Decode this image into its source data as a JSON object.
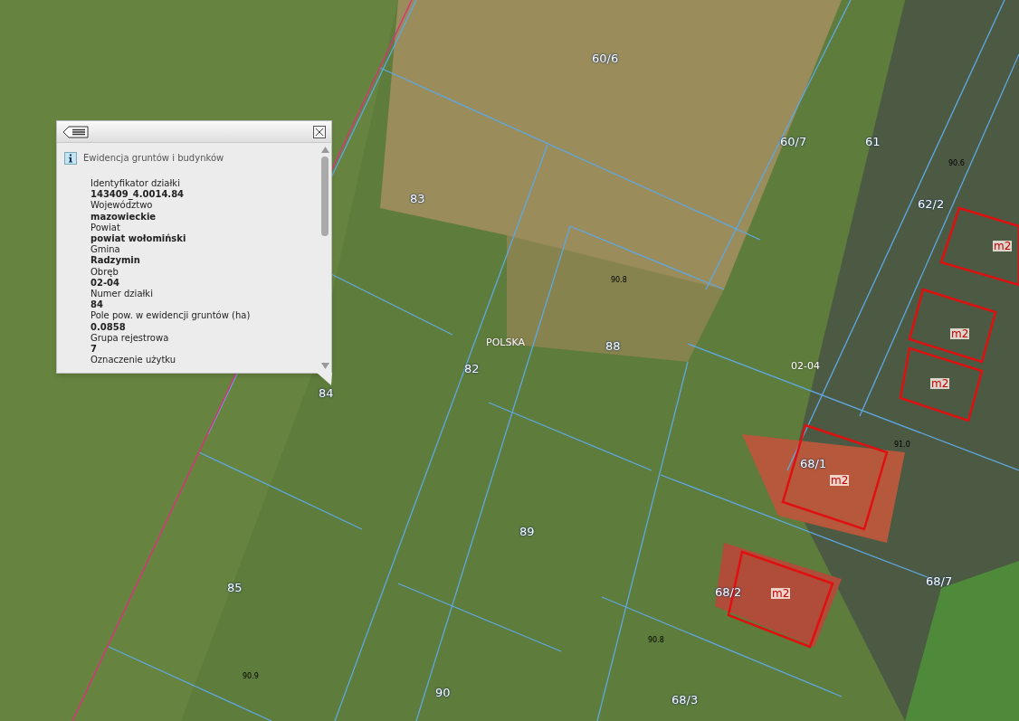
{
  "map": {
    "labels": [
      {
        "text": "60/6",
        "kind": "parcel"
      },
      {
        "text": "60/7",
        "kind": "parcel"
      },
      {
        "text": "61",
        "kind": "parcel"
      },
      {
        "text": "62/2",
        "kind": "parcel"
      },
      {
        "text": "83",
        "kind": "parcel"
      },
      {
        "text": "88",
        "kind": "parcel"
      },
      {
        "text": "82",
        "kind": "parcel"
      },
      {
        "text": "84",
        "kind": "parcel"
      },
      {
        "text": "POLSKA",
        "kind": "region"
      },
      {
        "text": "02-04",
        "kind": "region"
      },
      {
        "text": "89",
        "kind": "parcel"
      },
      {
        "text": "85",
        "kind": "parcel"
      },
      {
        "text": "90",
        "kind": "parcel"
      },
      {
        "text": "68/1",
        "kind": "parcel"
      },
      {
        "text": "68/2",
        "kind": "parcel"
      },
      {
        "text": "68/3",
        "kind": "parcel"
      },
      {
        "text": "68/7",
        "kind": "parcel"
      },
      {
        "text": "m2",
        "kind": "building"
      },
      {
        "text": "m2",
        "kind": "building"
      },
      {
        "text": "m2",
        "kind": "building"
      },
      {
        "text": "m2",
        "kind": "building"
      },
      {
        "text": "m2",
        "kind": "building"
      },
      {
        "text": "90.8",
        "kind": "height"
      },
      {
        "text": "90.9",
        "kind": "height"
      },
      {
        "text": "90.8",
        "kind": "height"
      },
      {
        "text": "91.0",
        "kind": "height"
      },
      {
        "text": "90.6",
        "kind": "height"
      }
    ]
  },
  "popup": {
    "title": "Ewidencja gruntów i budynków",
    "fields": [
      {
        "label": "Identyfikator działki",
        "value": "143409_4.0014.84"
      },
      {
        "label": "Województwo",
        "value": "mazowieckie"
      },
      {
        "label": "Powiat",
        "value": "powiat wołomiński"
      },
      {
        "label": "Gmina",
        "value": "Radzymin"
      },
      {
        "label": "Obręb",
        "value": "02-04"
      },
      {
        "label": "Numer działki",
        "value": "84"
      },
      {
        "label": "Pole pow. w ewidencji gruntów (ha)",
        "value": "0.0858"
      },
      {
        "label": "Grupa rejestrowa",
        "value": "7"
      },
      {
        "label": "Oznaczenie użytku"
      }
    ]
  }
}
